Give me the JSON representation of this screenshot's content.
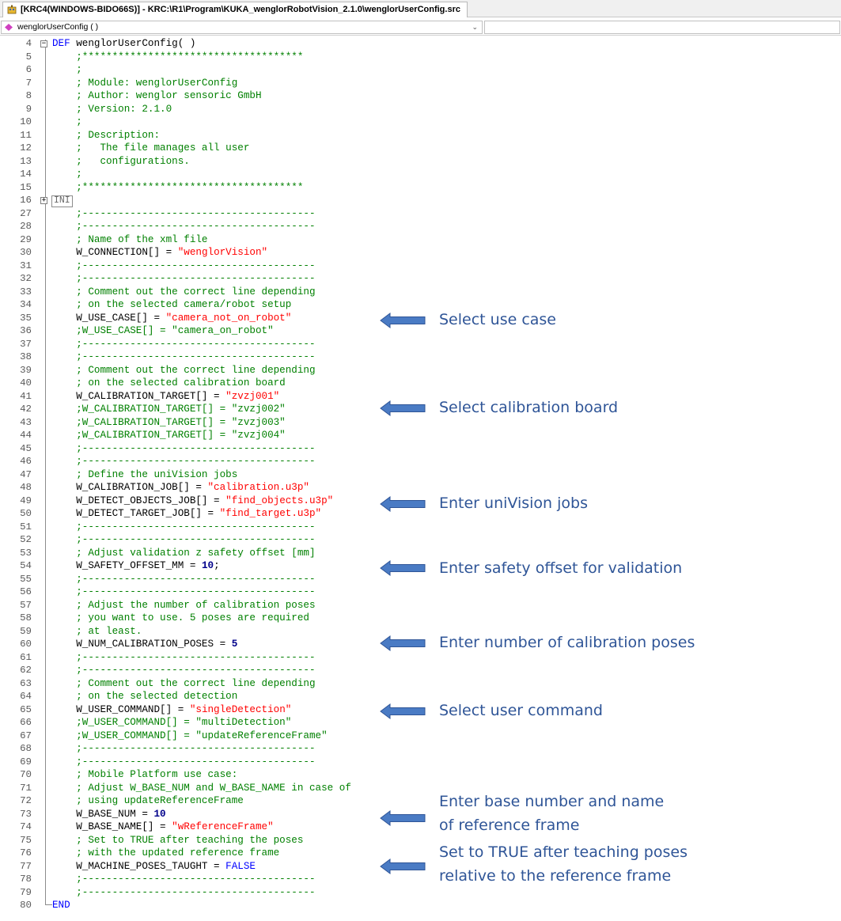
{
  "window": {
    "tab_title": "[KRC4(WINDOWS-BIDO66S)] - KRC:\\R1\\Program\\KUKA_wenglorRobotVision_2.1.0\\wenglorUserConfig.src",
    "function_selector": "wenglorUserConfig ( )"
  },
  "editor": {
    "lines": [
      {
        "n": "4",
        "parts": [
          [
            "kw",
            "DEF "
          ],
          [
            "",
            "wenglorUserConfig( )"
          ]
        ],
        "fold": "minus"
      },
      {
        "n": "5",
        "parts": [
          [
            "cm",
            "    ;*************************************"
          ]
        ]
      },
      {
        "n": "6",
        "parts": [
          [
            "cm",
            "    ;"
          ]
        ]
      },
      {
        "n": "7",
        "parts": [
          [
            "cm",
            "    ; Module: wenglorUserConfig"
          ]
        ]
      },
      {
        "n": "8",
        "parts": [
          [
            "cm",
            "    ; Author: wenglor sensoric GmbH"
          ]
        ]
      },
      {
        "n": "9",
        "parts": [
          [
            "cm",
            "    ; Version: 2.1.0"
          ]
        ]
      },
      {
        "n": "10",
        "parts": [
          [
            "cm",
            "    ;"
          ]
        ]
      },
      {
        "n": "11",
        "parts": [
          [
            "cm",
            "    ; Description:"
          ]
        ]
      },
      {
        "n": "12",
        "parts": [
          [
            "cm",
            "    ;   The file manages all user"
          ]
        ]
      },
      {
        "n": "13",
        "parts": [
          [
            "cm",
            "    ;   configurations."
          ]
        ]
      },
      {
        "n": "14",
        "parts": [
          [
            "cm",
            "    ;"
          ]
        ]
      },
      {
        "n": "15",
        "parts": [
          [
            "cm",
            "    ;*************************************"
          ]
        ]
      },
      {
        "n": "16",
        "parts": [],
        "fold": "plus",
        "ini": "INI"
      },
      {
        "n": "27",
        "parts": [
          [
            "cm",
            "    ;---------------------------------------"
          ]
        ]
      },
      {
        "n": "28",
        "parts": [
          [
            "cm",
            "    ;---------------------------------------"
          ]
        ]
      },
      {
        "n": "29",
        "parts": [
          [
            "cm",
            "    ; Name of the xml file"
          ]
        ]
      },
      {
        "n": "30",
        "parts": [
          [
            "",
            "    W_CONNECTION[] = "
          ],
          [
            "str",
            "\"wenglorVision\""
          ]
        ]
      },
      {
        "n": "31",
        "parts": [
          [
            "cm",
            "    ;---------------------------------------"
          ]
        ]
      },
      {
        "n": "32",
        "parts": [
          [
            "cm",
            "    ;---------------------------------------"
          ]
        ]
      },
      {
        "n": "33",
        "parts": [
          [
            "cm",
            "    ; Comment out the correct line depending"
          ]
        ]
      },
      {
        "n": "34",
        "parts": [
          [
            "cm",
            "    ; on the selected camera/robot setup"
          ]
        ]
      },
      {
        "n": "35",
        "parts": [
          [
            "",
            "    W_USE_CASE[] = "
          ],
          [
            "str",
            "\"camera_not_on_robot\""
          ]
        ]
      },
      {
        "n": "36",
        "parts": [
          [
            "cm",
            "    ;W_USE_CASE[] = \"camera_on_robot\""
          ]
        ]
      },
      {
        "n": "37",
        "parts": [
          [
            "cm",
            "    ;---------------------------------------"
          ]
        ]
      },
      {
        "n": "38",
        "parts": [
          [
            "cm",
            "    ;---------------------------------------"
          ]
        ]
      },
      {
        "n": "39",
        "parts": [
          [
            "cm",
            "    ; Comment out the correct line depending"
          ]
        ]
      },
      {
        "n": "40",
        "parts": [
          [
            "cm",
            "    ; on the selected calibration board"
          ]
        ]
      },
      {
        "n": "41",
        "parts": [
          [
            "",
            "    W_CALIBRATION_TARGET[] = "
          ],
          [
            "str",
            "\"zvzj001\""
          ]
        ]
      },
      {
        "n": "42",
        "parts": [
          [
            "cm",
            "    ;W_CALIBRATION_TARGET[] = \"zvzj002\""
          ]
        ]
      },
      {
        "n": "43",
        "parts": [
          [
            "cm",
            "    ;W_CALIBRATION_TARGET[] = \"zvzj003\""
          ]
        ]
      },
      {
        "n": "44",
        "parts": [
          [
            "cm",
            "    ;W_CALIBRATION_TARGET[] = \"zvzj004\""
          ]
        ]
      },
      {
        "n": "45",
        "parts": [
          [
            "cm",
            "    ;---------------------------------------"
          ]
        ]
      },
      {
        "n": "46",
        "parts": [
          [
            "cm",
            "    ;---------------------------------------"
          ]
        ]
      },
      {
        "n": "47",
        "parts": [
          [
            "cm",
            "    ; Define the uniVision jobs"
          ]
        ]
      },
      {
        "n": "48",
        "parts": [
          [
            "",
            "    W_CALIBRATION_JOB[] = "
          ],
          [
            "str",
            "\"calibration.u3p\""
          ]
        ]
      },
      {
        "n": "49",
        "parts": [
          [
            "",
            "    W_DETECT_OBJECTS_JOB[] = "
          ],
          [
            "str",
            "\"find_objects.u3p\""
          ]
        ]
      },
      {
        "n": "50",
        "parts": [
          [
            "",
            "    W_DETECT_TARGET_JOB[] = "
          ],
          [
            "str",
            "\"find_target.u3p\""
          ]
        ]
      },
      {
        "n": "51",
        "parts": [
          [
            "cm",
            "    ;---------------------------------------"
          ]
        ]
      },
      {
        "n": "52",
        "parts": [
          [
            "cm",
            "    ;---------------------------------------"
          ]
        ]
      },
      {
        "n": "53",
        "parts": [
          [
            "cm",
            "    ; Adjust validation z safety offset [mm]"
          ]
        ]
      },
      {
        "n": "54",
        "parts": [
          [
            "",
            "    W_SAFETY_OFFSET_MM = "
          ],
          [
            "num",
            "10"
          ],
          [
            "",
            ";"
          ]
        ]
      },
      {
        "n": "55",
        "parts": [
          [
            "cm",
            "    ;---------------------------------------"
          ]
        ]
      },
      {
        "n": "56",
        "parts": [
          [
            "cm",
            "    ;---------------------------------------"
          ]
        ]
      },
      {
        "n": "57",
        "parts": [
          [
            "cm",
            "    ; Adjust the number of calibration poses"
          ]
        ]
      },
      {
        "n": "58",
        "parts": [
          [
            "cm",
            "    ; you want to use. 5 poses are required"
          ]
        ]
      },
      {
        "n": "59",
        "parts": [
          [
            "cm",
            "    ; at least."
          ]
        ]
      },
      {
        "n": "60",
        "parts": [
          [
            "",
            "    W_NUM_CALIBRATION_POSES = "
          ],
          [
            "num",
            "5"
          ]
        ]
      },
      {
        "n": "61",
        "parts": [
          [
            "cm",
            "    ;---------------------------------------"
          ]
        ]
      },
      {
        "n": "62",
        "parts": [
          [
            "cm",
            "    ;---------------------------------------"
          ]
        ]
      },
      {
        "n": "63",
        "parts": [
          [
            "cm",
            "    ; Comment out the correct line depending"
          ]
        ]
      },
      {
        "n": "64",
        "parts": [
          [
            "cm",
            "    ; on the selected detection"
          ]
        ]
      },
      {
        "n": "65",
        "parts": [
          [
            "",
            "    W_USER_COMMAND[] = "
          ],
          [
            "str",
            "\"singleDetection\""
          ]
        ]
      },
      {
        "n": "66",
        "parts": [
          [
            "cm",
            "    ;W_USER_COMMAND[] = \"multiDetection\""
          ]
        ]
      },
      {
        "n": "67",
        "parts": [
          [
            "cm",
            "    ;W_USER_COMMAND[] = \"updateReferenceFrame\""
          ]
        ]
      },
      {
        "n": "68",
        "parts": [
          [
            "cm",
            "    ;---------------------------------------"
          ]
        ]
      },
      {
        "n": "69",
        "parts": [
          [
            "cm",
            "    ;---------------------------------------"
          ]
        ]
      },
      {
        "n": "70",
        "parts": [
          [
            "cm",
            "    ; Mobile Platform use case:"
          ]
        ]
      },
      {
        "n": "71",
        "parts": [
          [
            "cm",
            "    ; Adjust W_BASE_NUM and W_BASE_NAME in case of"
          ]
        ]
      },
      {
        "n": "72",
        "parts": [
          [
            "cm",
            "    ; using updateReferenceFrame"
          ]
        ]
      },
      {
        "n": "73",
        "parts": [
          [
            "",
            "    W_BASE_NUM = "
          ],
          [
            "num",
            "10"
          ]
        ]
      },
      {
        "n": "74",
        "parts": [
          [
            "",
            "    W_BASE_NAME[] = "
          ],
          [
            "str",
            "\"wReferenceFrame\""
          ]
        ]
      },
      {
        "n": "75",
        "parts": [
          [
            "cm",
            "    ; Set to TRUE after teaching the poses"
          ]
        ]
      },
      {
        "n": "76",
        "parts": [
          [
            "cm",
            "    ; with the updated reference frame"
          ]
        ]
      },
      {
        "n": "77",
        "parts": [
          [
            "",
            "    W_MACHINE_POSES_TAUGHT = "
          ],
          [
            "kw",
            "FALSE"
          ]
        ]
      },
      {
        "n": "78",
        "parts": [
          [
            "cm",
            "    ;---------------------------------------"
          ]
        ]
      },
      {
        "n": "79",
        "parts": [
          [
            "cm",
            "    ;---------------------------------------"
          ]
        ]
      },
      {
        "n": "80",
        "parts": [
          [
            "kw",
            "END"
          ]
        ],
        "end": true
      }
    ]
  },
  "annotations": {
    "use_case": [
      "Select use case"
    ],
    "calibration_board": [
      "Select calibration board"
    ],
    "univision_jobs": [
      "Enter uniVision jobs"
    ],
    "safety_offset": [
      "Enter safety offset for validation"
    ],
    "calibration_poses": [
      "Enter number of calibration poses"
    ],
    "user_command": [
      "Select user command"
    ],
    "base": [
      "Enter base number and name",
      "of reference frame"
    ],
    "poses_taught": [
      "Set to TRUE after teaching poses",
      "relative to the reference frame"
    ]
  },
  "colors": {
    "keyword": "#0000ff",
    "comment": "#008000",
    "string": "#ff0000",
    "number": "#00008b",
    "annotation_text": "#2f5597",
    "arrow_fill": "#4a7bc4"
  }
}
